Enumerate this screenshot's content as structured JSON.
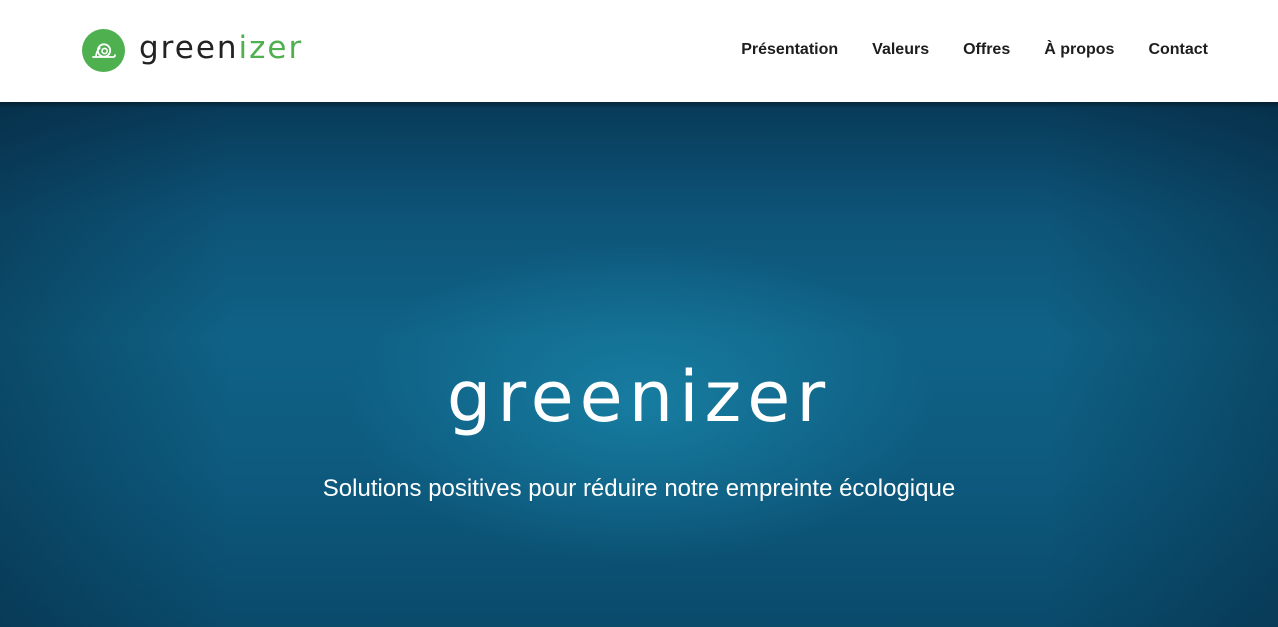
{
  "header": {
    "logo": {
      "icon": "snail-icon",
      "word_main": "green",
      "word_accent": "izer",
      "accent_color": "#4fb04f"
    },
    "nav": [
      {
        "label": "Présentation"
      },
      {
        "label": "Valeurs"
      },
      {
        "label": "Offres"
      },
      {
        "label": "À propos"
      },
      {
        "label": "Contact"
      }
    ]
  },
  "hero": {
    "title": "greenizer",
    "subtitle": "Solutions positives pour réduire notre empreinte écologique"
  }
}
